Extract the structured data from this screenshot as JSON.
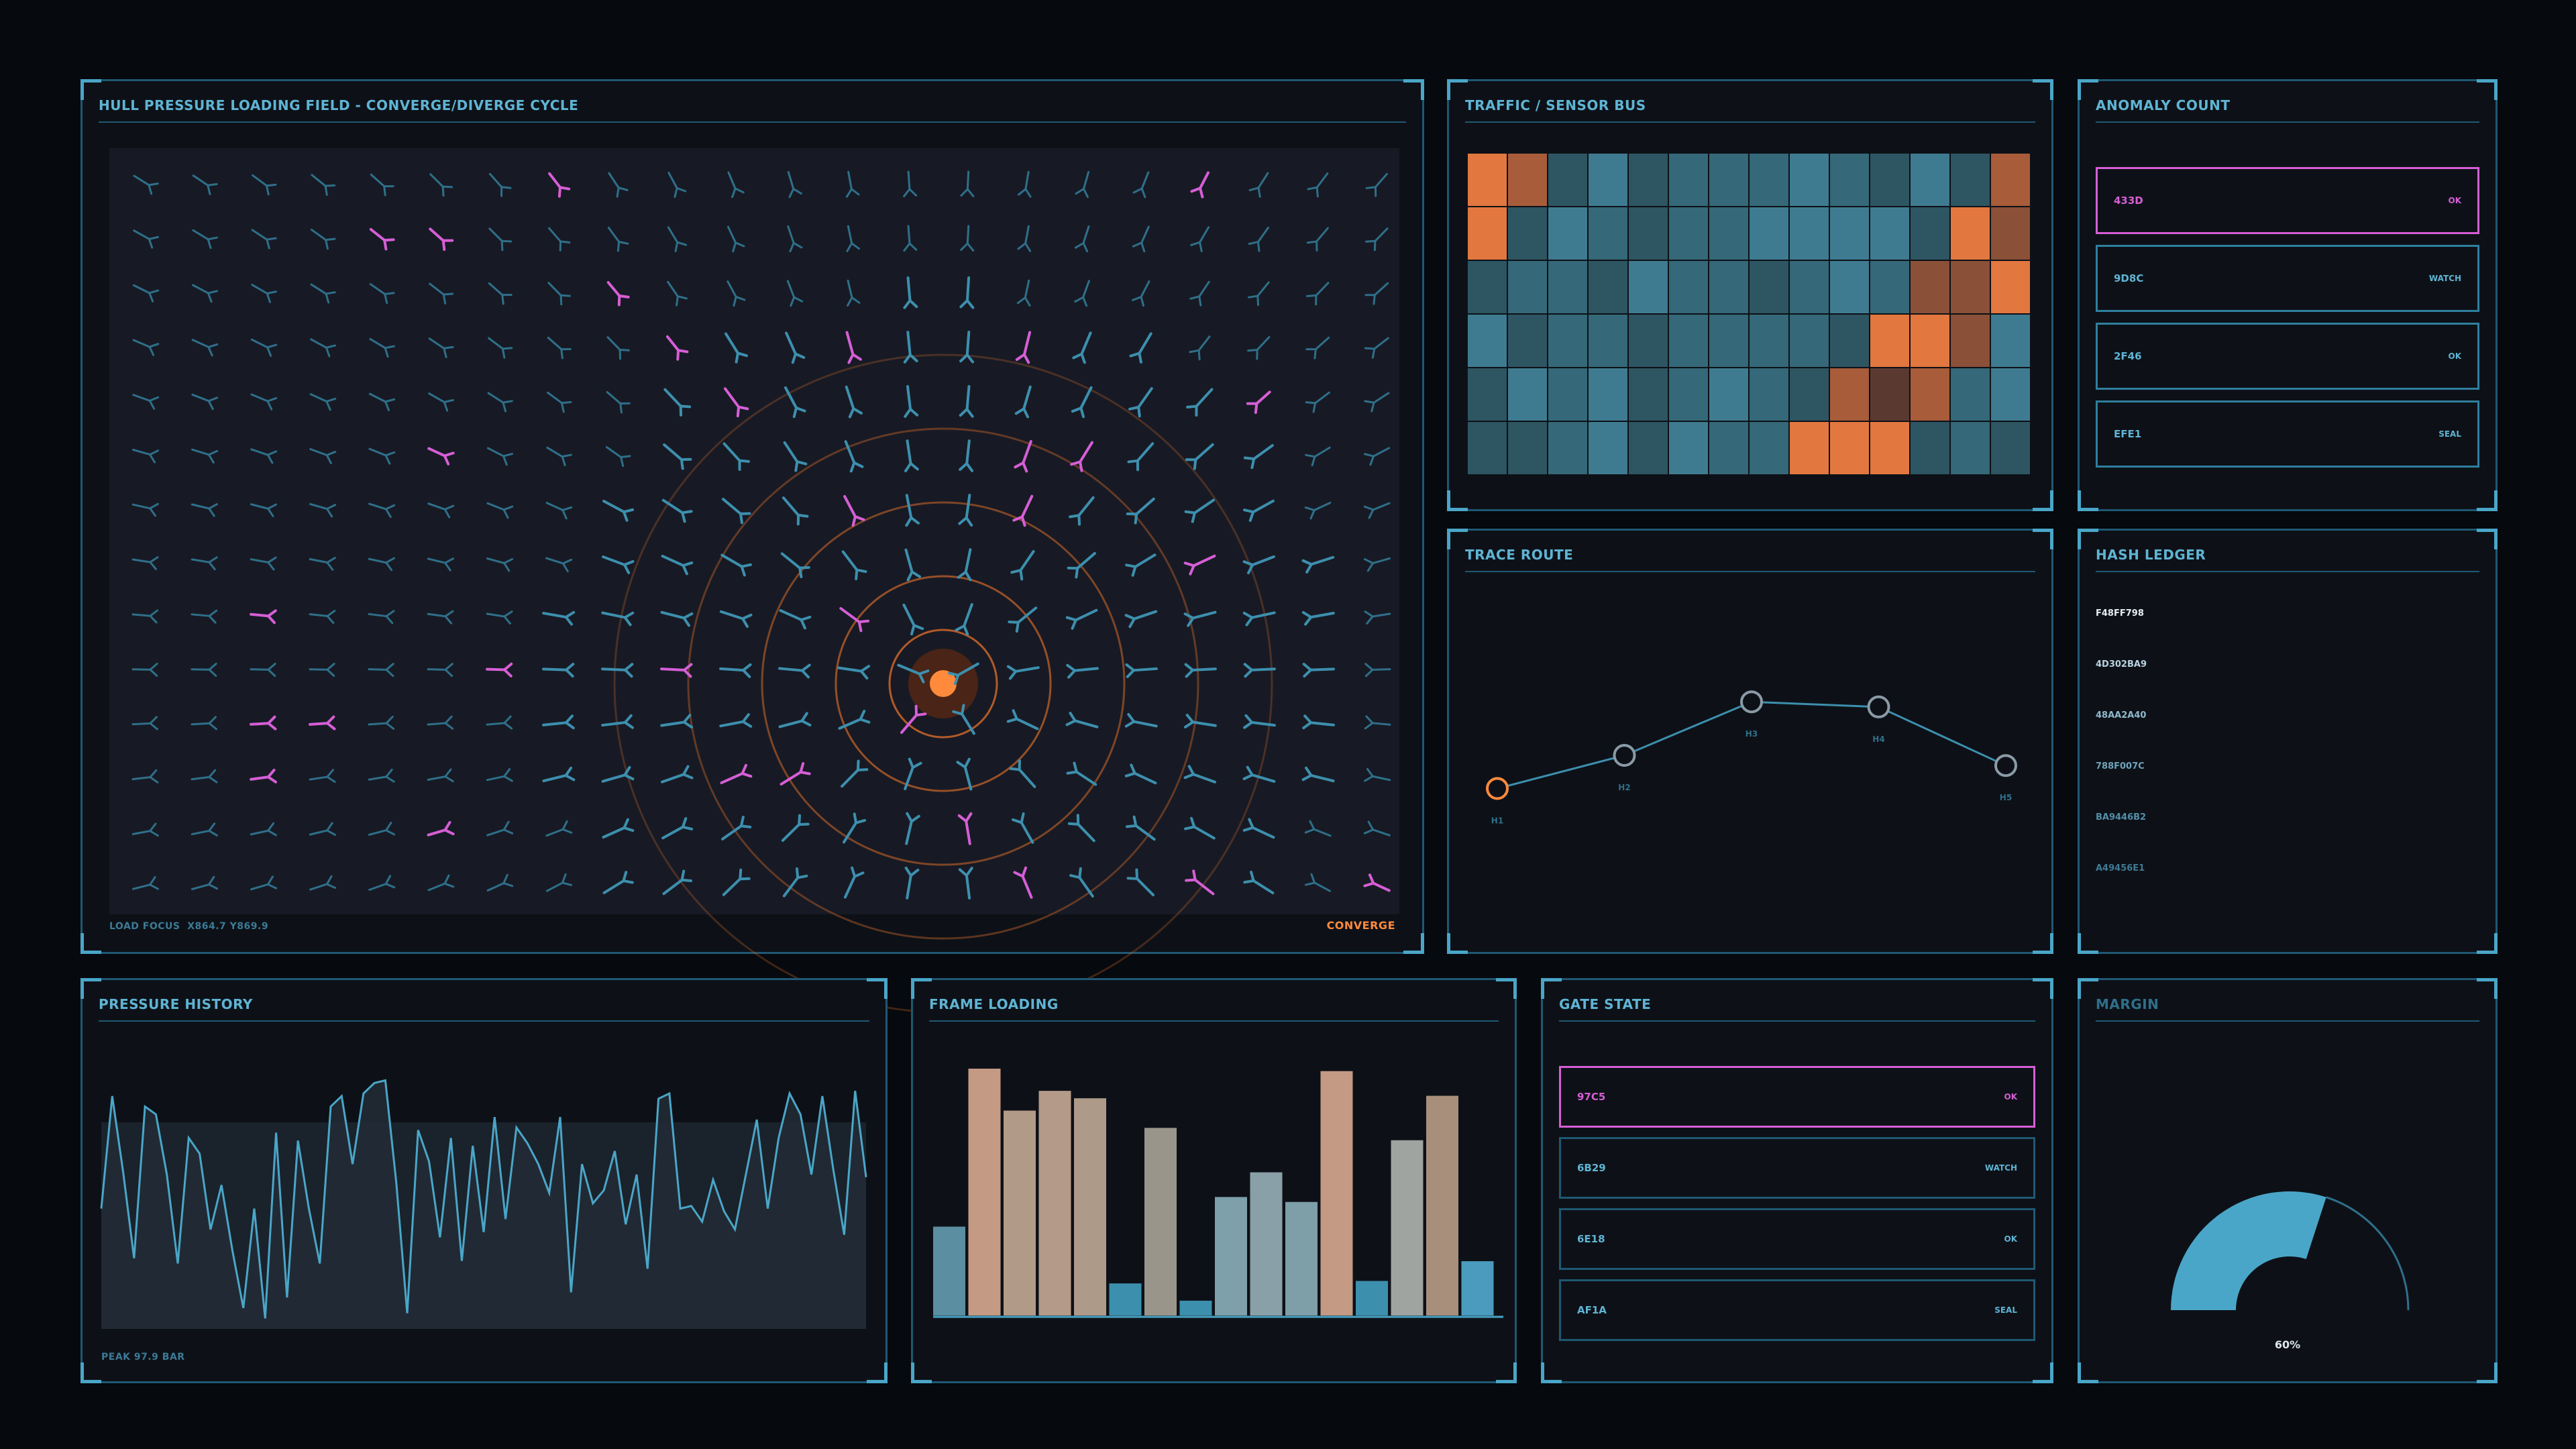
{
  "colors": {
    "accent": "#5fb4d4",
    "border": "#1f5873",
    "alert": "#d65ed6",
    "orange": "#ff8a3c"
  },
  "field": {
    "title": "HULL PRESSURE LOADING FIELD - CONVERGE/DIVERGE CYCLE",
    "focus_label": "LOAD FOCUS",
    "focus_value": "X864.7 Y869.9",
    "mode": "CONVERGE"
  },
  "traffic": {
    "title": "TRAFFIC / SENSOR BUS",
    "grid": [
      [
        9,
        8,
        1,
        3,
        1,
        2,
        2,
        2,
        3,
        2,
        1,
        3,
        1,
        8
      ],
      [
        9,
        1,
        3,
        2,
        1,
        2,
        2,
        3,
        3,
        3,
        3,
        1,
        9,
        7
      ],
      [
        1,
        2,
        2,
        1,
        3,
        2,
        2,
        1,
        2,
        3,
        2,
        7,
        7,
        9
      ],
      [
        3,
        1,
        2,
        2,
        1,
        2,
        2,
        2,
        2,
        1,
        9,
        9,
        7,
        3
      ],
      [
        1,
        3,
        2,
        3,
        1,
        2,
        3,
        2,
        1,
        8,
        6,
        8,
        2,
        3
      ],
      [
        1,
        1,
        2,
        3,
        1,
        3,
        2,
        2,
        9,
        9,
        9,
        1,
        2,
        1
      ]
    ]
  },
  "anomaly": {
    "title": "ANOMALY COUNT",
    "rows": [
      {
        "id": "433D",
        "status": "OK",
        "hl": true
      },
      {
        "id": "9D8C",
        "status": "WATCH",
        "hl": false
      },
      {
        "id": "2F46",
        "status": "OK",
        "hl": false
      },
      {
        "id": "EFE1",
        "status": "SEAL",
        "hl": false
      }
    ]
  },
  "trace": {
    "title": "TRACE ROUTE",
    "hops": [
      {
        "label": "H1",
        "v": 0.24
      },
      {
        "label": "H2",
        "v": 0.5
      },
      {
        "label": "H3",
        "v": 0.92
      },
      {
        "label": "H4",
        "v": 0.88
      },
      {
        "label": "H5",
        "v": 0.42
      }
    ]
  },
  "ledger": {
    "title": "HASH LEDGER",
    "hashes": [
      "F48FF798",
      "4D302BA9",
      "48AA2A40",
      "788F007C",
      "BA9446B2",
      "A49456E1"
    ]
  },
  "pressure": {
    "title": "PRESSURE HISTORY",
    "peak": "PEAK 97.9 BAR"
  },
  "frame": {
    "title": "FRAME LOADING"
  },
  "gate": {
    "title": "GATE STATE",
    "rows": [
      {
        "id": "97C5",
        "status": "OK",
        "hl": true
      },
      {
        "id": "6B29",
        "status": "WATCH",
        "hl": false
      },
      {
        "id": "6E18",
        "status": "OK",
        "hl": false
      },
      {
        "id": "AF1A",
        "status": "SEAL",
        "hl": false
      }
    ]
  },
  "margin": {
    "title": "MARGIN",
    "value": 0.6,
    "label": "60%"
  },
  "chart_data": [
    {
      "type": "line",
      "name": "pressure-history",
      "title": "PRESSURE HISTORY",
      "values": [
        46,
        89,
        60,
        27,
        85,
        82,
        59,
        25,
        73,
        67,
        38,
        55,
        30,
        8,
        46,
        4,
        75,
        12,
        72,
        46,
        25,
        85,
        89,
        63,
        90,
        94,
        95,
        56,
        6,
        76,
        64,
        35,
        73,
        26,
        70,
        37,
        81,
        42,
        77,
        71,
        63,
        52,
        81,
        14,
        63,
        48,
        53,
        68,
        40,
        59,
        23,
        88,
        90,
        46,
        47,
        41,
        57,
        45,
        38,
        59,
        80,
        46,
        73,
        90,
        82,
        59,
        89,
        61,
        36,
        91,
        58
      ],
      "ylim": [
        0,
        100
      ]
    },
    {
      "type": "bar",
      "name": "frame-loading",
      "title": "FRAME LOADING",
      "values": [
        36,
        100,
        83,
        91,
        88,
        13,
        76,
        6,
        48,
        58,
        46,
        99,
        14,
        71,
        89,
        22
      ],
      "ylim": [
        0,
        100
      ]
    }
  ]
}
